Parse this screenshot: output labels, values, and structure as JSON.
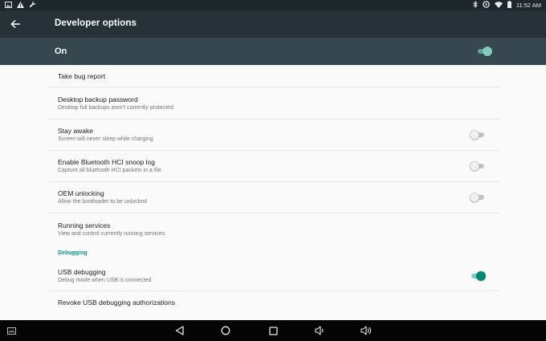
{
  "status_bar": {
    "left_icons": [
      "gallery-icon",
      "warning-icon",
      "wrench-icon"
    ],
    "right_icons": [
      "bluetooth-icon",
      "data-saver-icon",
      "wifi-icon",
      "battery-icon"
    ],
    "time": "11:52 AM"
  },
  "app_bar": {
    "title": "Developer options",
    "back_icon": "arrow-back-icon"
  },
  "master_switch": {
    "label": "On",
    "enabled": true
  },
  "items": [
    {
      "title": "Take bug report",
      "subtitle": ""
    },
    {
      "title": "Desktop backup password",
      "subtitle": "Desktop full backups aren’t currently protected"
    },
    {
      "title": "Stay awake",
      "subtitle": "Screen will never sleep while charging",
      "switch": false
    },
    {
      "title": "Enable Bluetooth HCI snoop log",
      "subtitle": "Capture all bluetooth HCI packets in a file",
      "switch": false
    },
    {
      "title": "OEM unlocking",
      "subtitle": "Allow the bootloader to be unlocked",
      "switch": false
    },
    {
      "title": "Running services",
      "subtitle": "View and control currently running services"
    }
  ],
  "debugging": {
    "category": "Debugging",
    "items": [
      {
        "title": "USB debugging",
        "subtitle": "Debug mode when USB is connected",
        "switch": true
      },
      {
        "title": "Revoke USB debugging authorizations",
        "subtitle": ""
      }
    ]
  },
  "nav_bar": {
    "buttons": [
      "screenshot-icon",
      "back-icon",
      "home-icon",
      "recents-icon",
      "volume-down-icon",
      "volume-up-icon"
    ]
  },
  "colors": {
    "status_bar": "#1e272b",
    "app_bar": "#263238",
    "master_bar": "#37474f",
    "accent": "#009688",
    "nav_bar": "#050505"
  }
}
